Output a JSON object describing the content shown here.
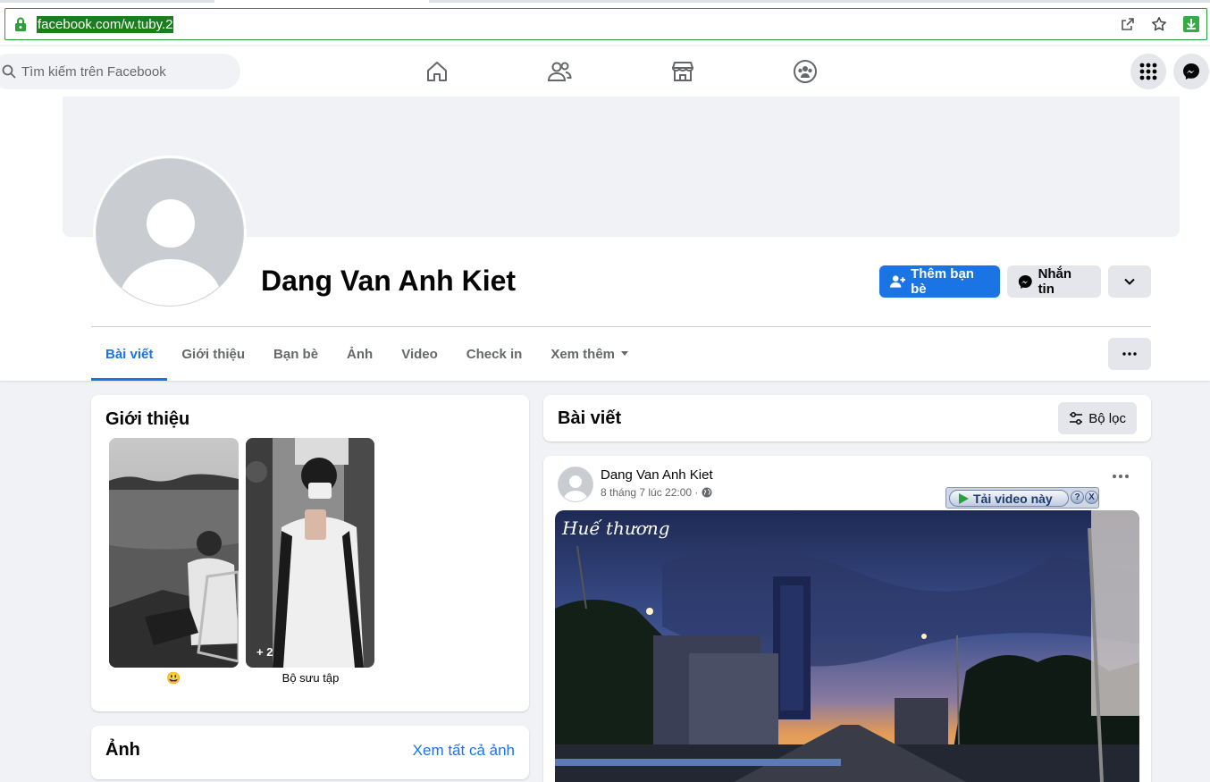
{
  "browser": {
    "url": "facebook.com/w.tuby.2",
    "icons": [
      "lock-icon",
      "share-icon",
      "star-icon",
      "download-icon"
    ]
  },
  "topbar": {
    "search_placeholder": "Tìm kiếm trên Facebook",
    "nav_icons": [
      "home-icon",
      "friends-icon",
      "marketplace-icon",
      "groups-icon"
    ],
    "right_icons": [
      "menu-grid-icon",
      "messenger-icon"
    ]
  },
  "profile": {
    "name": "Dang Van Anh Kiet",
    "add_friend_label": "Thêm bạn bè",
    "message_label": "Nhắn tin"
  },
  "tabs": [
    {
      "label": "Bài viết",
      "active": true
    },
    {
      "label": "Giới thiệu"
    },
    {
      "label": "Bạn bè"
    },
    {
      "label": "Ảnh"
    },
    {
      "label": "Video"
    },
    {
      "label": "Check in"
    },
    {
      "label": "Xem thêm"
    }
  ],
  "intro": {
    "title": "Giới thiệu",
    "featured": [
      {
        "caption": "😃"
      },
      {
        "caption": "Bộ sưu tập",
        "overlay": "+ 2"
      }
    ]
  },
  "photos": {
    "title": "Ảnh",
    "see_all": "Xem tất cả ảnh"
  },
  "posts": {
    "title": "Bài viết",
    "filter_label": "Bộ lọc"
  },
  "post": {
    "author": "Dang Van Anh Kiet",
    "time": "8 tháng 7 lúc 22:00 ·",
    "download_label": "Tải video này",
    "help_label": "?",
    "close_label": "X",
    "watermark": "Huế thương"
  },
  "colors": {
    "fb_blue": "#1b74e4",
    "url_highlight": "#1a7f1a",
    "background": "#f0f2f5"
  }
}
